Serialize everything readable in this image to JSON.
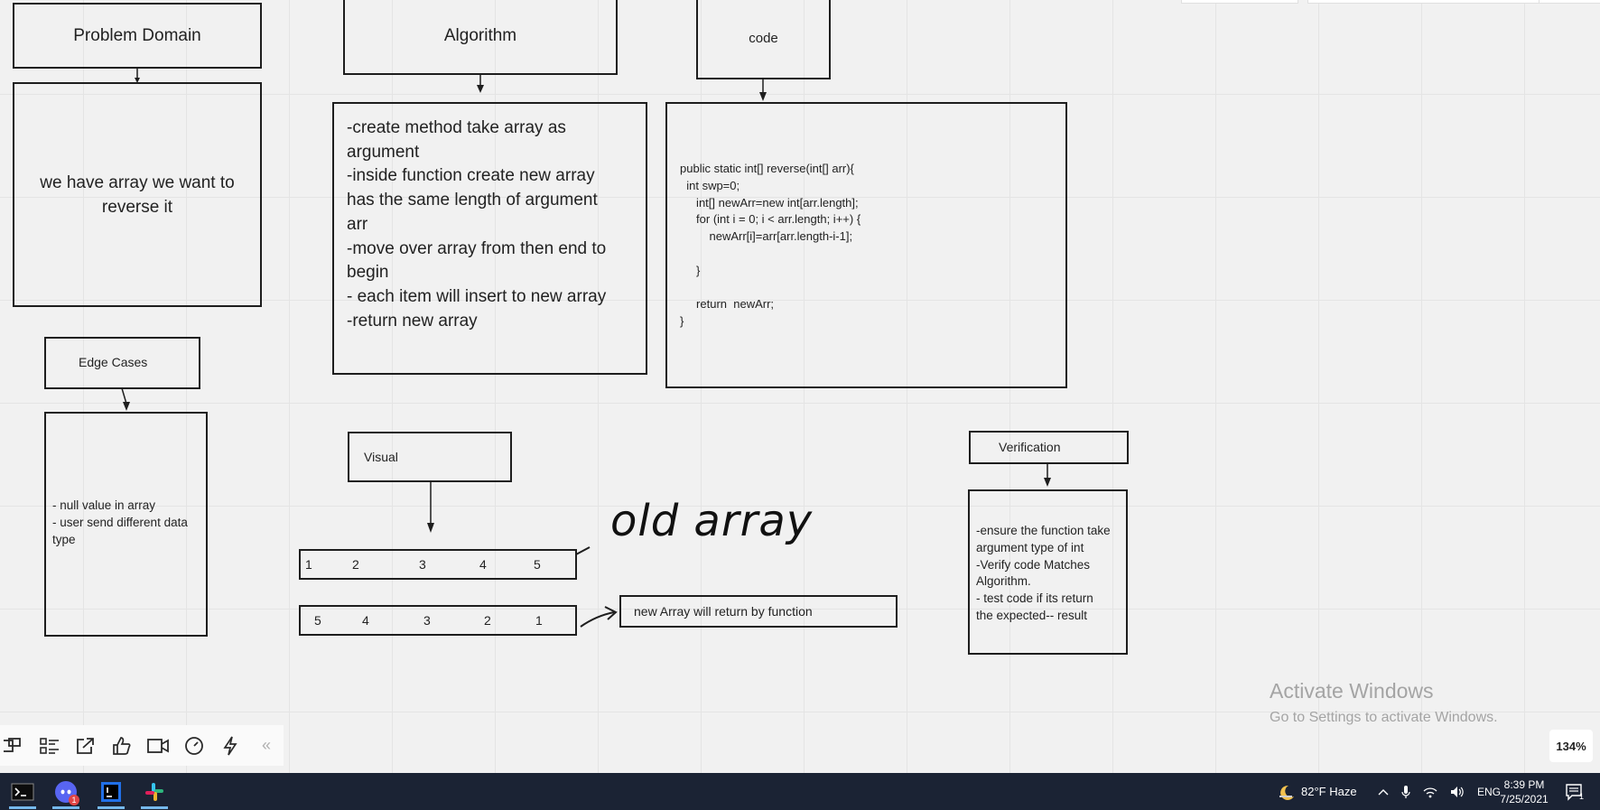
{
  "board": {
    "problem_domain": {
      "title": "Problem Domain",
      "body": "we have array we want to\nreverse it"
    },
    "algorithm": {
      "title": "Algorithm",
      "body": "-create method take array as\nargument\n-inside function create new array\nhas the same length of argument\narr\n-move over array from then end to\nbegin\n- each item will insert to new array\n-return new array"
    },
    "code": {
      "title": "code",
      "body": "public static int[] reverse(int[] arr){\n  int swp=0;\n     int[] newArr=new int[arr.length];\n     for (int i = 0; i < arr.length; i++) {\n         newArr[i]=arr[arr.length-i-1];\n\n     }\n\n     return  newArr;\n}"
    },
    "edge_cases": {
      "title": "Edge Cases",
      "body": "- null value in array\n- user send different data\ntype"
    },
    "visual": {
      "title": "Visual",
      "old_array": [
        "1",
        "2",
        "3",
        "4",
        "5"
      ],
      "new_array": [
        "5",
        "4",
        "3",
        "2",
        "1"
      ],
      "handwritten_label": "old array",
      "new_array_label": "new Array will return by function"
    },
    "verification": {
      "title": "Verification",
      "body": "-ensure the function take\nargument type of int\n-Verify code Matches\nAlgorithm.\n- test code if its return\nthe expected-- result"
    }
  },
  "toolbar": {
    "icons": [
      "frames-icon",
      "list-icon",
      "share-icon",
      "like-icon",
      "video-icon",
      "timer-icon",
      "lightning-icon",
      "collapse-icon"
    ],
    "collapse_label": "«"
  },
  "zoom": {
    "level": "134%"
  },
  "watermark": {
    "line1": "Activate Windows",
    "line2": "Go to Settings to activate Windows."
  },
  "taskbar": {
    "apps": [
      "terminal-icon",
      "discord-icon",
      "intellij-icon",
      "slack-icon"
    ],
    "discord_badge": "1",
    "weather": "82°F  Haze",
    "language": "ENG",
    "time": "8:39 PM",
    "date": "7/25/2021",
    "notification_count": "1"
  },
  "colors": {
    "canvas": "#f1f1f1",
    "stroke": "#1e1e1e",
    "taskbar": "#1b2334",
    "accent": "#76b9ed"
  }
}
